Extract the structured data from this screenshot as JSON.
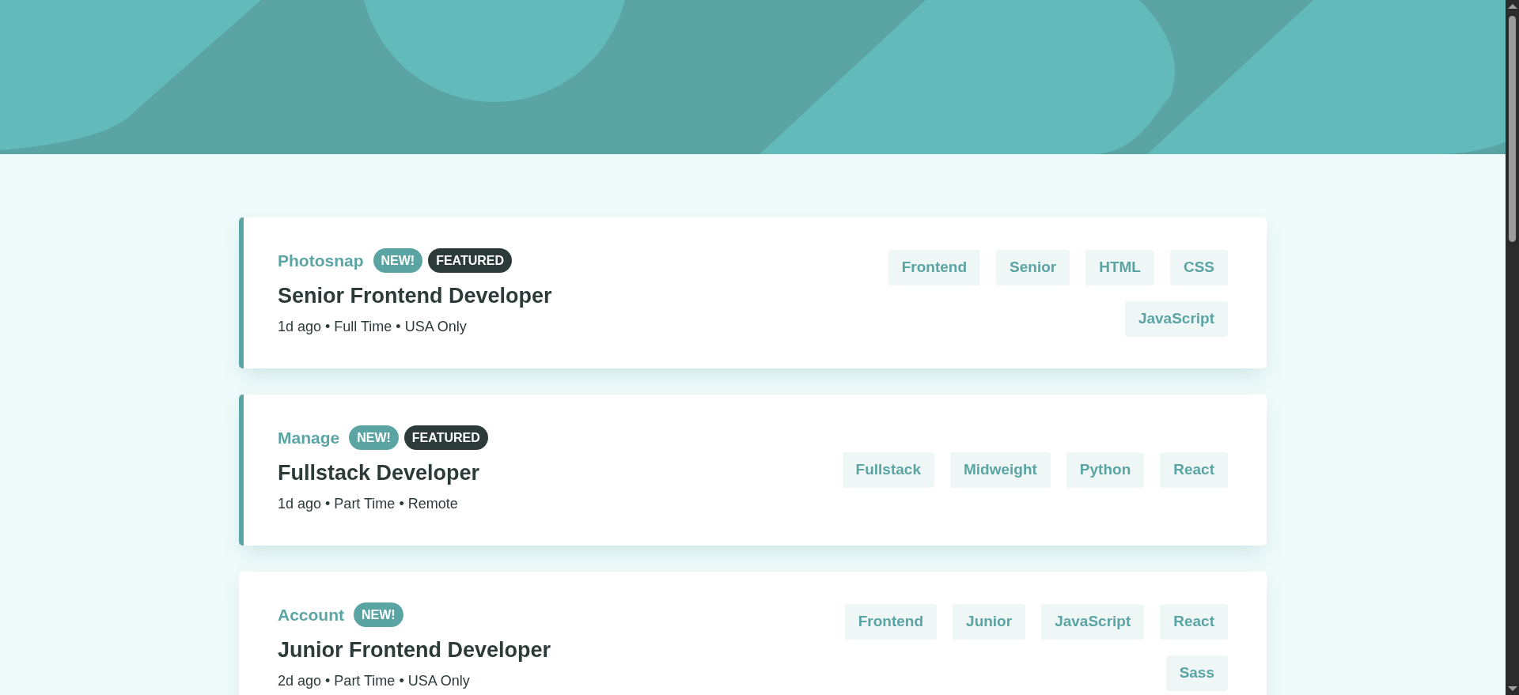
{
  "jobs": [
    {
      "company": "Photosnap",
      "featured": true,
      "badges": [
        {
          "kind": "new",
          "label": "NEW!"
        },
        {
          "kind": "featured",
          "label": "FEATURED"
        }
      ],
      "position": "Senior Frontend Developer",
      "meta": "1d ago • Full Time • USA Only",
      "tags": [
        "Frontend",
        "Senior",
        "HTML",
        "CSS",
        "JavaScript"
      ]
    },
    {
      "company": "Manage",
      "featured": true,
      "badges": [
        {
          "kind": "new",
          "label": "NEW!"
        },
        {
          "kind": "featured",
          "label": "FEATURED"
        }
      ],
      "position": "Fullstack Developer",
      "meta": "1d ago • Part Time • Remote",
      "tags": [
        "Fullstack",
        "Midweight",
        "Python",
        "React"
      ]
    },
    {
      "company": "Account",
      "featured": false,
      "badges": [
        {
          "kind": "new",
          "label": "NEW!"
        }
      ],
      "position": "Junior Frontend Developer",
      "meta": "2d ago • Part Time • USA Only",
      "tags": [
        "Frontend",
        "Junior",
        "JavaScript",
        "React",
        "Sass"
      ]
    }
  ]
}
